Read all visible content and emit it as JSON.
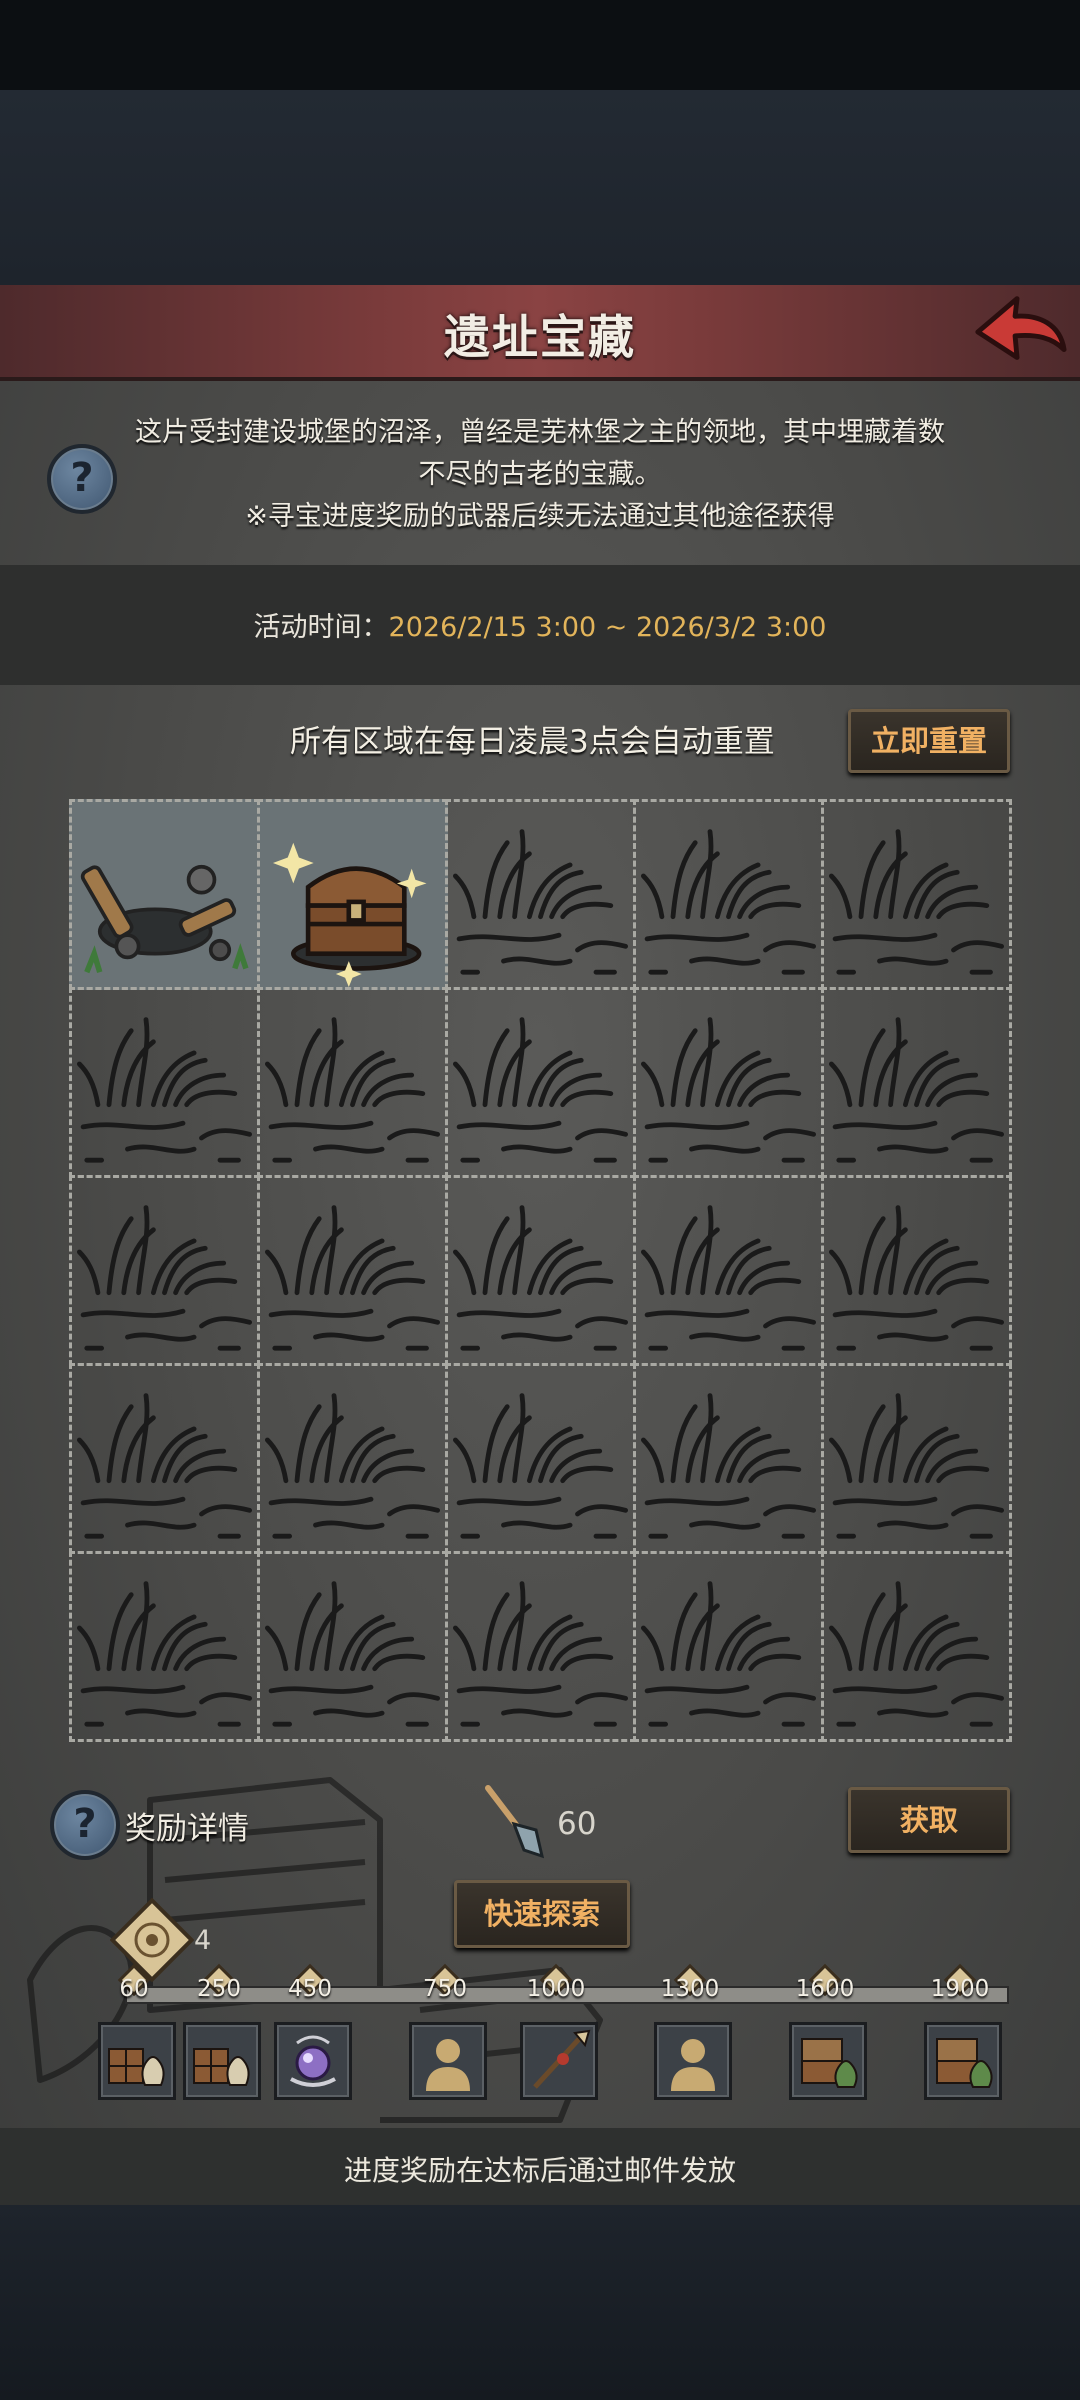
{
  "header": {
    "title": "遗址宝藏",
    "back_icon": "back-arrow-icon"
  },
  "description": {
    "line1": "这片受封建设城堡的沼泽，曾经是芜林堡之主的领地，其中埋藏着数",
    "line2": "不尽的古老的宝藏。",
    "note": "※寻宝进度奖励的武器后续无法通过其他途径获得"
  },
  "event_time": {
    "label": "活动时间：",
    "value": "2026/2/15 3:00 ~ 2026/3/2 3:00"
  },
  "reset": {
    "text": "所有区域在每日凌晨3点会自动重置",
    "button": "立即重置"
  },
  "grid": {
    "rows": 5,
    "cols": 5,
    "cells": [
      "dug",
      "treasure",
      "grass",
      "grass",
      "grass",
      "grass",
      "grass",
      "grass",
      "grass",
      "grass",
      "grass",
      "grass",
      "grass",
      "grass",
      "grass",
      "grass",
      "grass",
      "grass",
      "grass",
      "grass",
      "grass",
      "grass",
      "grass",
      "grass",
      "grass"
    ]
  },
  "rewards": {
    "label": "奖励详情",
    "shovel_count": "60",
    "get_button": "获取",
    "quick_explore_button": "快速探索",
    "points": "4",
    "milestones": [
      {
        "value": "60",
        "item": "crate-and-bag-icon"
      },
      {
        "value": "250",
        "item": "crate-and-bag-icon"
      },
      {
        "value": "450",
        "item": "purple-orb-icon"
      },
      {
        "value": "750",
        "item": "character-silhouette-icon"
      },
      {
        "value": "1000",
        "item": "spear-weapon-icon"
      },
      {
        "value": "1300",
        "item": "character-silhouette-icon"
      },
      {
        "value": "1600",
        "item": "crates-and-bag-icon"
      },
      {
        "value": "1900",
        "item": "crates-and-bag-icon"
      }
    ],
    "progress_fraction": 0.0
  },
  "footer": {
    "text": "进度奖励在达标后通过邮件发放"
  },
  "colors": {
    "title_bar": "#7a3b3b",
    "accent_orange": "#f1b163",
    "time_gold": "#e2b45a"
  }
}
